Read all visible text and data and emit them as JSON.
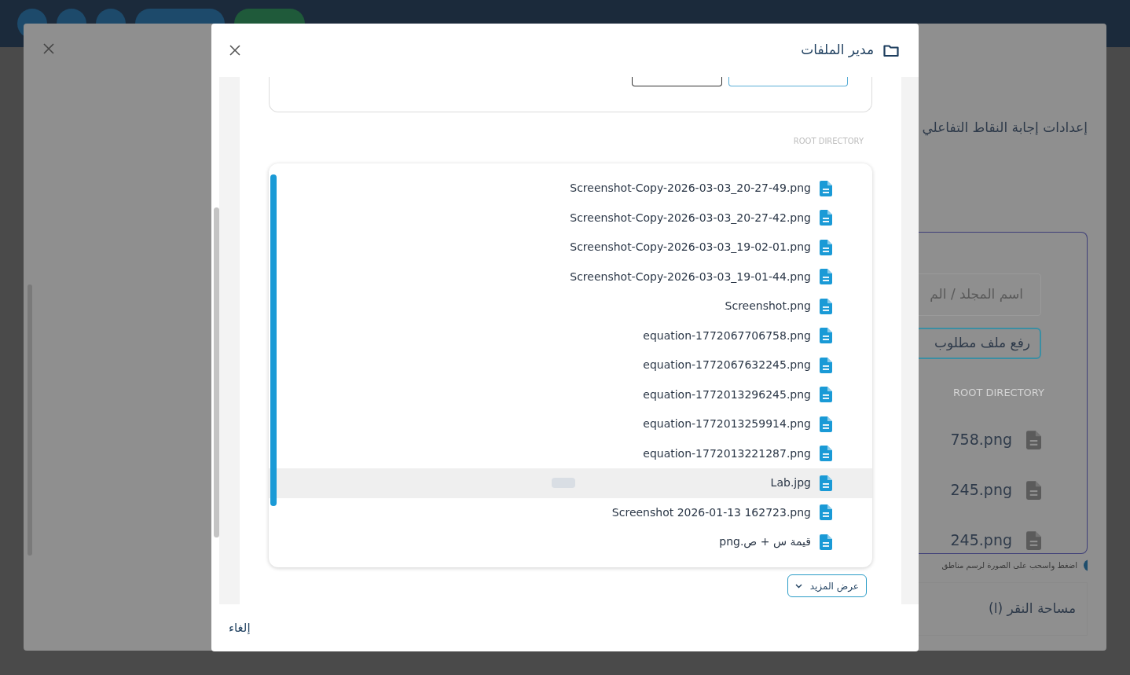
{
  "background_dialog": {
    "heading": "إعدادات إجابة النقاط التفاعلي",
    "folder_field": {
      "placeholder": "اسم المجلد / الم"
    },
    "upload_button": "رفع ملف مطلوب",
    "directory_label": "ROOT DIRECTORY",
    "files": [
      "758.png",
      "245.png",
      "245.png"
    ],
    "hint": "اضغط واسحب على الصورة لرسم مناطق",
    "click_area_title": "مساحة النقر (ا)"
  },
  "file_manager": {
    "title": "مدير الملفات",
    "directory_label": "ROOT DIRECTORY",
    "files": [
      {
        "name": "Screenshot-Copy-2026-03-03_20-27-49.png",
        "selected": false
      },
      {
        "name": "Screenshot-Copy-2026-03-03_20-27-42.png",
        "selected": false
      },
      {
        "name": "Screenshot-Copy-2026-03-03_19-02-01.png",
        "selected": false
      },
      {
        "name": "Screenshot-Copy-2026-03-03_19-01-44.png",
        "selected": false
      },
      {
        "name": "Screenshot.png",
        "selected": false
      },
      {
        "name": "equation-1772067706758.png",
        "selected": false
      },
      {
        "name": "equation-1772067632245.png",
        "selected": false
      },
      {
        "name": "equation-1772013296245.png",
        "selected": false
      },
      {
        "name": "equation-1772013259914.png",
        "selected": false
      },
      {
        "name": "equation-1772013221287.png",
        "selected": false
      },
      {
        "name": "Lab.jpg",
        "selected": true
      },
      {
        "name": "Screenshot 2026-01-13 162723.png",
        "selected": false
      },
      {
        "name": "قيمة س + ص.png",
        "selected": false
      }
    ],
    "show_more_button": "عرض المزيد",
    "cancel_button": "إلغاء"
  }
}
